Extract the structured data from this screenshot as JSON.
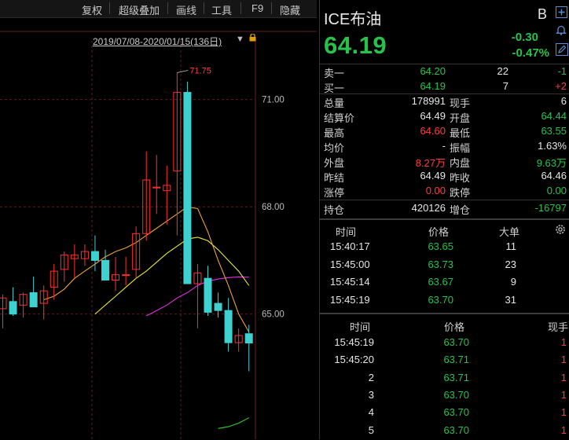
{
  "toolbar": {
    "items": [
      "复权",
      "超级叠加",
      "画线",
      "工具",
      "F9",
      "隐藏"
    ]
  },
  "chart": {
    "range_label": "2019/07/08-2020/01/15(136日)",
    "y_ticks": [
      "71.00",
      "68.00",
      "65.00"
    ],
    "max_label": "71.75",
    "colors": {
      "up": "#ff3030",
      "down": "#3fd0d0",
      "ma5": "#e8a23a",
      "ma10": "#e8e830",
      "ma20": "#e030e0",
      "ma60": "#30d030"
    }
  },
  "chart_data": {
    "type": "candlestick",
    "series_colors": {
      "up": "#ff3030",
      "down": "#3fd0d0"
    },
    "candles": [
      {
        "o": 65.15,
        "h": 65.55,
        "l": 64.6,
        "c": 65.45
      },
      {
        "o": 65.35,
        "h": 65.75,
        "l": 64.95,
        "c": 65.0
      },
      {
        "o": 65.25,
        "h": 65.6,
        "l": 64.9,
        "c": 65.55
      },
      {
        "o": 65.6,
        "h": 66.05,
        "l": 65.25,
        "c": 65.2
      },
      {
        "o": 65.3,
        "h": 65.8,
        "l": 64.85,
        "c": 65.65
      },
      {
        "o": 65.75,
        "h": 66.4,
        "l": 65.4,
        "c": 66.2
      },
      {
        "o": 66.25,
        "h": 66.75,
        "l": 65.9,
        "c": 66.65
      },
      {
        "o": 66.55,
        "h": 66.95,
        "l": 66.0,
        "c": 66.65
      },
      {
        "o": 66.55,
        "h": 66.95,
        "l": 66.35,
        "c": 66.75
      },
      {
        "o": 66.75,
        "h": 67.2,
        "l": 66.2,
        "c": 66.5
      },
      {
        "o": 66.5,
        "h": 66.8,
        "l": 65.95,
        "c": 65.95
      },
      {
        "o": 65.95,
        "h": 66.6,
        "l": 65.65,
        "c": 66.1
      },
      {
        "o": 66.1,
        "h": 66.6,
        "l": 65.8,
        "c": 66.1
      },
      {
        "o": 66.25,
        "h": 67.45,
        "l": 66.0,
        "c": 67.25
      },
      {
        "o": 67.25,
        "h": 69.55,
        "l": 67.05,
        "c": 68.75
      },
      {
        "o": 68.55,
        "h": 69.45,
        "l": 67.8,
        "c": 68.55
      },
      {
        "o": 68.45,
        "h": 69.15,
        "l": 67.5,
        "c": 68.6
      },
      {
        "o": 69.0,
        "h": 71.75,
        "l": 67.2,
        "c": 71.2
      },
      {
        "o": 71.2,
        "h": 71.5,
        "l": 66.65,
        "c": 65.85
      },
      {
        "o": 65.85,
        "h": 66.4,
        "l": 64.6,
        "c": 66.15
      },
      {
        "o": 66.0,
        "h": 66.35,
        "l": 64.95,
        "c": 65.05
      },
      {
        "o": 65.3,
        "h": 65.6,
        "l": 64.9,
        "c": 65.1
      },
      {
        "o": 65.1,
        "h": 65.45,
        "l": 63.95,
        "c": 64.2
      },
      {
        "o": 64.2,
        "h": 64.6,
        "l": 63.95,
        "c": 64.4
      },
      {
        "o": 64.45,
        "h": 64.7,
        "l": 63.4,
        "c": 64.19
      }
    ],
    "ma5": [
      null,
      null,
      null,
      null,
      65.4,
      65.5,
      65.7,
      66.0,
      66.2,
      66.4,
      66.6,
      66.75,
      66.85,
      67.0,
      67.2,
      67.4,
      67.6,
      67.8,
      68.0,
      67.95,
      67.3,
      66.5,
      65.8,
      65.0,
      64.5
    ],
    "ma10": [
      null,
      null,
      null,
      null,
      null,
      null,
      null,
      null,
      null,
      65.0,
      65.25,
      65.5,
      65.75,
      66.0,
      66.2,
      66.45,
      66.7,
      66.9,
      67.1,
      67.15,
      67.05,
      66.8,
      66.5,
      66.2,
      65.8
    ],
    "ma20": [
      null,
      null,
      null,
      null,
      null,
      null,
      null,
      null,
      null,
      null,
      null,
      null,
      null,
      null,
      64.95,
      65.1,
      65.25,
      65.45,
      65.6,
      65.8,
      65.92,
      65.98,
      66.02,
      66.04,
      66.03
    ],
    "ma60": [
      null,
      null,
      null,
      null,
      null,
      null,
      null,
      null,
      null,
      null,
      null,
      null,
      null,
      null,
      null,
      null,
      null,
      null,
      null,
      null,
      null,
      61.8,
      61.85,
      61.95,
      62.1
    ],
    "ylim": [
      61.5,
      73.3
    ]
  },
  "quote": {
    "title": "ICE布油",
    "badge": "B",
    "last": "64.19",
    "change": "-0.30",
    "change_pct": "-0.47%",
    "sell1": {
      "label": "卖一",
      "price": "64.20",
      "vol": "22",
      "chg": "-1"
    },
    "buy1": {
      "label": "买一",
      "price": "64.19",
      "vol": "7",
      "chg": "+2"
    },
    "stats": [
      {
        "l1": "总量",
        "v1": "178991",
        "c1": "wht",
        "l2": "现手",
        "v2": "6",
        "c2": "wht"
      },
      {
        "l1": "结算价",
        "v1": "64.49",
        "c1": "wht",
        "l2": "开盘",
        "v2": "64.44",
        "c2": "grn"
      },
      {
        "l1": "最高",
        "v1": "64.60",
        "c1": "red",
        "l2": "最低",
        "v2": "63.55",
        "c2": "grn"
      },
      {
        "l1": "均价",
        "v1": "-",
        "c1": "wht",
        "l2": "振幅",
        "v2": "1.63%",
        "c2": "wht"
      },
      {
        "l1": "外盘",
        "v1": "8.27万",
        "c1": "red",
        "l2": "内盘",
        "v2": "9.63万",
        "c2": "grn"
      },
      {
        "l1": "昨结",
        "v1": "64.49",
        "c1": "wht",
        "l2": "昨收",
        "v2": "64.46",
        "c2": "wht"
      },
      {
        "l1": "涨停",
        "v1": "0.00",
        "c1": "red",
        "l2": "跌停",
        "v2": "0.00",
        "c2": "grn"
      }
    ],
    "oi": {
      "l1": "持仓",
      "v1": "420126",
      "l2": "增仓",
      "v2": "-16797"
    }
  },
  "big_orders": {
    "headers": [
      "时间",
      "价格",
      "大单"
    ],
    "rows": [
      {
        "time": "15:40:17",
        "price": "63.65",
        "vol": "11"
      },
      {
        "time": "15:45:00",
        "price": "63.73",
        "vol": "23"
      },
      {
        "time": "15:45:14",
        "price": "63.67",
        "vol": "9"
      },
      {
        "time": "15:45:19",
        "price": "63.70",
        "vol": "31"
      }
    ]
  },
  "ticks": {
    "headers": [
      "时间",
      "价格",
      "现手"
    ],
    "rows": [
      {
        "time": "15:45:19",
        "price": "63.70",
        "vol": "1"
      },
      {
        "time": "15:45:20",
        "price": "63.71",
        "vol": "1"
      },
      {
        "time": "2",
        "price": "63.71",
        "vol": "1"
      },
      {
        "time": "3",
        "price": "63.70",
        "vol": "1"
      },
      {
        "time": "4",
        "price": "63.70",
        "vol": "1"
      },
      {
        "time": "5",
        "price": "63.70",
        "vol": "1"
      }
    ]
  }
}
